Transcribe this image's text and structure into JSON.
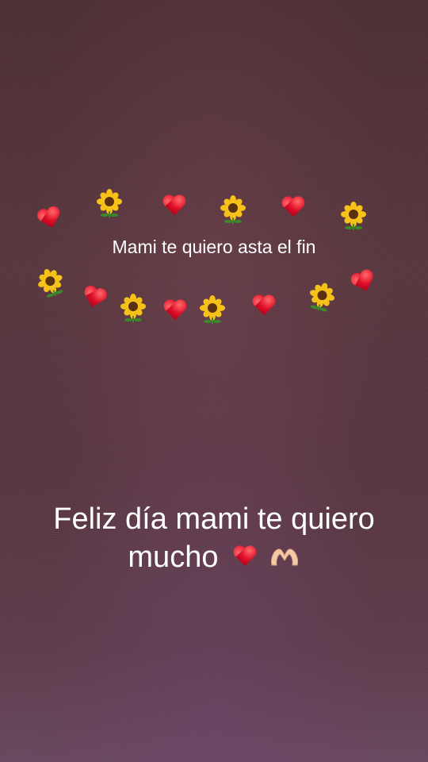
{
  "story": {
    "top_caption": "Mami te quiero asta el fin",
    "bottom_caption": "Feliz día mami te quiero mucho",
    "decorations": [
      "heart-icon",
      "sunflower-icon",
      "heart-hands-icon"
    ]
  }
}
